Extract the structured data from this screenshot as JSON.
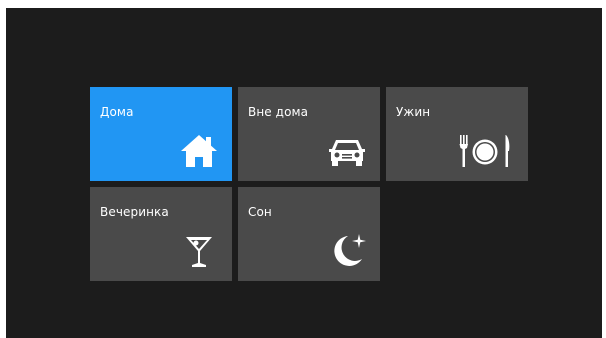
{
  "colors": {
    "background": "#1c1c1c",
    "tile": "#4a4a4a",
    "tile_active": "#2196f3",
    "text": "#ffffff"
  },
  "scenes": [
    {
      "label": "Дома",
      "icon": "home-icon",
      "active": true
    },
    {
      "label": "Вне дома",
      "icon": "car-icon",
      "active": false
    },
    {
      "label": "Ужин",
      "icon": "dinner-icon",
      "active": false
    },
    {
      "label": "Вечеринка",
      "icon": "cocktail-icon",
      "active": false
    },
    {
      "label": "Сон",
      "icon": "moon-icon",
      "active": false
    }
  ]
}
